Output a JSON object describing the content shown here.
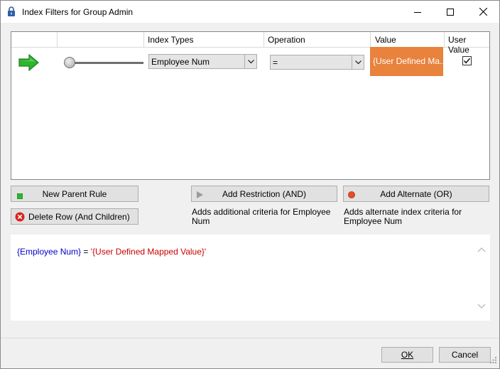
{
  "window": {
    "title": "Index Filters for Group Admin",
    "icon": "lock-icon"
  },
  "grid": {
    "columns": [
      "",
      "",
      "Index Types",
      "Operation",
      "Value",
      "User Value"
    ],
    "rows": [
      {
        "arrow_icon": "green-arrow-icon",
        "level": 0,
        "index_type": "Employee Num",
        "operation": "=",
        "value": "{User Defined Ma...",
        "user_value_checked": true
      }
    ],
    "value_color": "#e8823c"
  },
  "buttons": {
    "new_parent_rule": "New Parent Rule",
    "delete_row": "Delete Row (And Children)",
    "add_restriction": "Add Restriction (AND)",
    "add_alternate": "Add Alternate (OR)",
    "ok": "OK",
    "cancel": "Cancel"
  },
  "hints": {
    "restriction": "Adds additional criteria for Employee Num",
    "alternate": "Adds alternate index criteria for Employee Num"
  },
  "expression": {
    "field": "{Employee Num}",
    "operator": " = ",
    "value": "'{User Defined Mapped Value}'"
  },
  "colors": {
    "field": "#0000c8",
    "value": "#c80000",
    "green": "#2db52d",
    "red": "#d9241c"
  }
}
